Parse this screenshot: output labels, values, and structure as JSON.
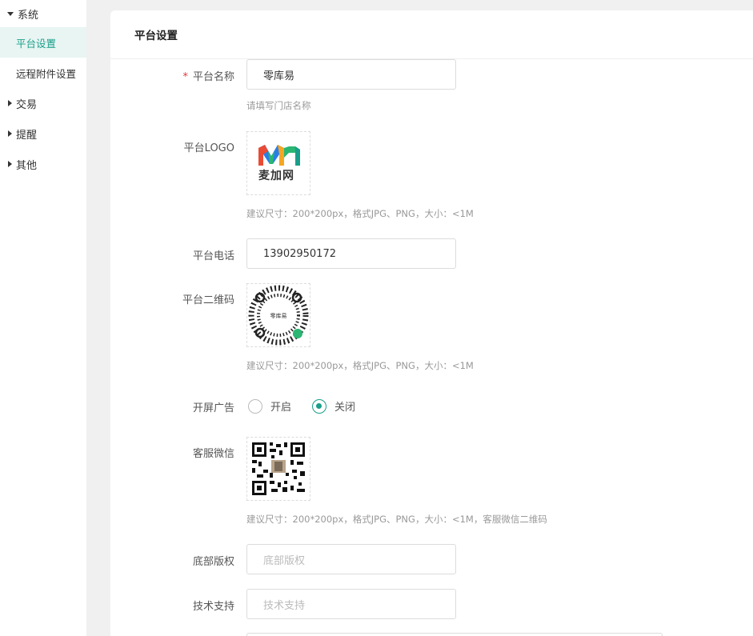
{
  "sidebar": {
    "groups": [
      {
        "label": "系统",
        "expanded": true
      },
      {
        "label": "交易",
        "expanded": false
      },
      {
        "label": "提醒",
        "expanded": false
      },
      {
        "label": "其他",
        "expanded": false
      }
    ],
    "items": [
      {
        "label": "平台设置",
        "active": true
      },
      {
        "label": "远程附件设置",
        "active": false
      }
    ]
  },
  "card": {
    "title": "平台设置"
  },
  "form": {
    "name": {
      "label": "平台名称",
      "required_mark": "*",
      "value": "零库易",
      "hint": "请填写门店名称"
    },
    "logo": {
      "label": "平台LOGO",
      "logo_text": "麦加网",
      "hint": "建议尺寸：200*200px，格式JPG、PNG，大小：<1M"
    },
    "phone": {
      "label": "平台电话",
      "value": "13902950172"
    },
    "qrcode": {
      "label": "平台二维码",
      "center_text": "零库易",
      "hint": "建议尺寸：200*200px，格式JPG、PNG，大小：<1M"
    },
    "splash": {
      "label": "开屏广告",
      "options": [
        "开启",
        "关闭"
      ],
      "selected": "关闭"
    },
    "wechat": {
      "label": "客服微信",
      "hint": "建议尺寸：200*200px，格式JPG、PNG，大小：<1M，客服微信二维码"
    },
    "copyright": {
      "label": "底部版权",
      "placeholder": "底部版权"
    },
    "support": {
      "label": "技术支持",
      "placeholder": "技术支持"
    }
  },
  "colors": {
    "accent": "#1a9e8a",
    "required": "#e4393c",
    "active_bg": "#e8f5f3"
  }
}
